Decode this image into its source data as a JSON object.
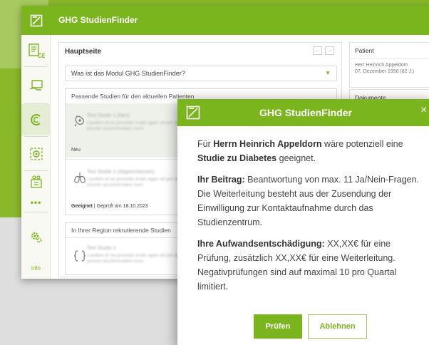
{
  "app": {
    "title": "GHG StudienFinder",
    "accent_color": "#7ab51d",
    "logo_icon": "app-logo-icon"
  },
  "sidebar": {
    "items": [
      {
        "icon": "ce-document-icon"
      },
      {
        "icon": "hand-card-icon"
      },
      {
        "icon": "c-logo-icon"
      },
      {
        "icon": "target-icon"
      },
      {
        "icon": "people-building-icon"
      },
      {
        "icon": "gear-icon"
      }
    ],
    "more": "•••",
    "info_label": "info"
  },
  "main": {
    "heading": "Hauptseite",
    "faq_dropdown": "Was ist das Modul GHG StudienFinder?",
    "matching_section_title": "Passende Studien für den aktuellen Patienten",
    "studies": [
      {
        "icon": "disease-icon",
        "title": "Test Studie 1 (Neu)",
        "desc": "Laudem et ne possidar eratic agas vel per ad pro possim accommodare nunc",
        "status": "Neu",
        "date": ""
      },
      {
        "icon": "lungs-icon",
        "title": "Test Studie 2 (Abgeschlossen)",
        "desc": "Laudem et ne possidar eratic agas vel per ad pro possim accommodare nunc",
        "status": "Geeignet",
        "date": "Geprüft am 18.10.2023"
      }
    ],
    "region_section_title": "In Ihrer Region rekrutierende Studien",
    "region_study": {
      "icon": "bracket-icon",
      "title": "Test Studie 3",
      "desc": "Laudem et ne possidar eratic agas vel per ad pro possim accommodare nunc"
    }
  },
  "right_panel": {
    "patient_label": "Patient",
    "patient_name": "Herr Heinrich Appeldorn",
    "patient_dob": "07. Dezember 1956 (62 J.)",
    "documents_label": "Dokumente"
  },
  "modal": {
    "title": "GHG StudienFinder",
    "close": "×",
    "p1_pre": "Für ",
    "p1_patient": "Herrn Heinrich Appeldorn",
    "p1_mid": " wäre potenziell eine ",
    "p1_study": "Studie zu Diabetes",
    "p1_post": " geeignet.",
    "p2_label": "Ihr Beitrag:",
    "p2_text": " Beantwortung von max. 11 Ja/Nein-Fragen. Die Weiterleitung besteht aus der Zusendung der Einwilligung zur Kontaktaufnahme durch das Studienzentrum.",
    "p3_label": "Ihre Aufwandsentschädigung:",
    "p3_text": " XX,XX€ für eine Prüfung, zusätzlich XX,XX€ für eine Weiterleitung. Negativprüfungen sind auf maximal 10 pro Quartal limitiert.",
    "primary_button": "Prüfen",
    "secondary_button": "Ablehnen"
  }
}
